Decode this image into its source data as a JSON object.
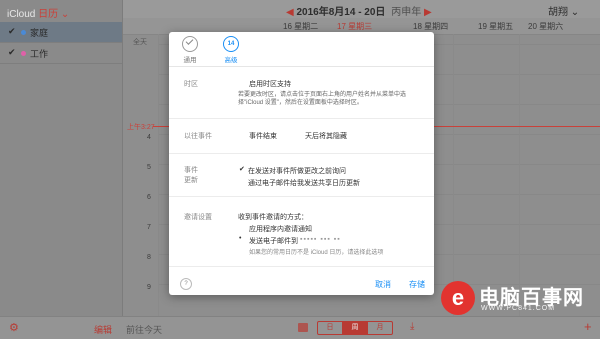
{
  "app": {
    "brand_icloud": "iCloud",
    "brand_calendar": "日历",
    "calendars": [
      {
        "name": "家庭",
        "checked": true,
        "color": "#4a8ad6"
      },
      {
        "name": "工作",
        "checked": true,
        "color": "#e060a8"
      }
    ]
  },
  "header": {
    "prev_arrow": "◀",
    "next_arrow": "▶",
    "date_range": "2016年8月14 - 20日",
    "ganzhi": "丙申年",
    "user_name": "胡翔"
  },
  "day_headers": [
    "16 星期二",
    "17 星期三",
    "18 星期四",
    "19 星期五",
    "20 星期六"
  ],
  "all_day_label": "全天",
  "hour_labels": [
    "",
    "",
    "",
    "4",
    "5",
    "6",
    "7",
    "8",
    "9",
    "10"
  ],
  "now_label": "上午3:27",
  "bottom": {
    "edit": "编辑",
    "go_today": "前往今天",
    "views": [
      "日",
      "周",
      "月"
    ],
    "active_view": "周"
  },
  "modal": {
    "tabs": [
      {
        "label": "通用"
      },
      {
        "label": "高级",
        "icon_text": "14"
      }
    ],
    "timezone": {
      "label": "时区",
      "option": "启用时区支持",
      "desc": "若要更改时区，请点击位于页面右上角的用户姓名并从菜单中选择\"iCloud 设置\"，然后在设置面板中选择时区。"
    },
    "past_events": {
      "label": "以往事件",
      "option_a": "事件结束",
      "option_b": "天后将其隐藏"
    },
    "event_changes": {
      "label_line1": "事件",
      "label_line2": "更新",
      "option_a": "在发送对事件所做更改之前询问",
      "option_b": "通过电子邮件给我发送共享日历更新"
    },
    "invitations": {
      "label": "邀请设置",
      "title": "收到事件邀请的方式：",
      "option_a": "应用程序内邀请通知",
      "option_b": "发送电子邮件到",
      "masked": "▪▪▪▪▪ ▪▪▪ ▪▪",
      "note": "如果您的常用日历不是 iCloud 日历，请选择此选项"
    },
    "help": "?",
    "cancel": "取消",
    "save": "存储"
  },
  "watermark": {
    "logo": "e",
    "title": "电脑百事网",
    "url": "WWW.PC841.COM"
  }
}
